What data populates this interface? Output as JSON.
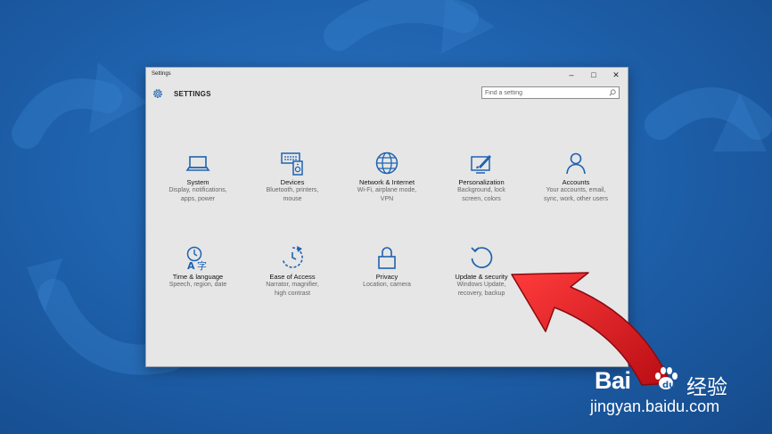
{
  "window": {
    "title": "Settings",
    "controls": {
      "minimize": "–",
      "maximize": "□",
      "close": "✕"
    },
    "header": {
      "label": "SETTINGS",
      "icon": "gear-icon"
    }
  },
  "search": {
    "placeholder": "Find a setting",
    "icon": "search-icon"
  },
  "categories": [
    {
      "icon": "laptop-icon",
      "title": "System",
      "desc1": "Display, notifications,",
      "desc2": "apps, power"
    },
    {
      "icon": "devices-icon",
      "title": "Devices",
      "desc1": "Bluetooth, printers,",
      "desc2": "mouse"
    },
    {
      "icon": "globe-icon",
      "title": "Network & Internet",
      "desc1": "Wi-Fi, airplane mode,",
      "desc2": "VPN"
    },
    {
      "icon": "paint-icon",
      "title": "Personalization",
      "desc1": "Background, lock",
      "desc2": "screen, colors"
    },
    {
      "icon": "person-icon",
      "title": "Accounts",
      "desc1": "Your accounts, email,",
      "desc2": "sync, work, other users"
    },
    {
      "icon": "language-icon",
      "title": "Time & language",
      "desc1": "Speech, region, date",
      "desc2": ""
    },
    {
      "icon": "ease-of-access-icon",
      "title": "Ease of Access",
      "desc1": "Narrator, magnifier,",
      "desc2": "high contrast"
    },
    {
      "icon": "lock-icon",
      "title": "Privacy",
      "desc1": "Location, camera",
      "desc2": ""
    },
    {
      "icon": "refresh-icon",
      "title": "Update & security",
      "desc1": "Windows Update,",
      "desc2": "recovery, backup"
    }
  ],
  "watermark": {
    "logo": "Bai  ",
    "cn": "经验",
    "url": "jingyan.baidu.com"
  },
  "colors": {
    "accent": "#1e63b0",
    "window_bg": "#e6e6e6",
    "arrow": "#e0151e",
    "desktop": "#1d5ea8"
  }
}
